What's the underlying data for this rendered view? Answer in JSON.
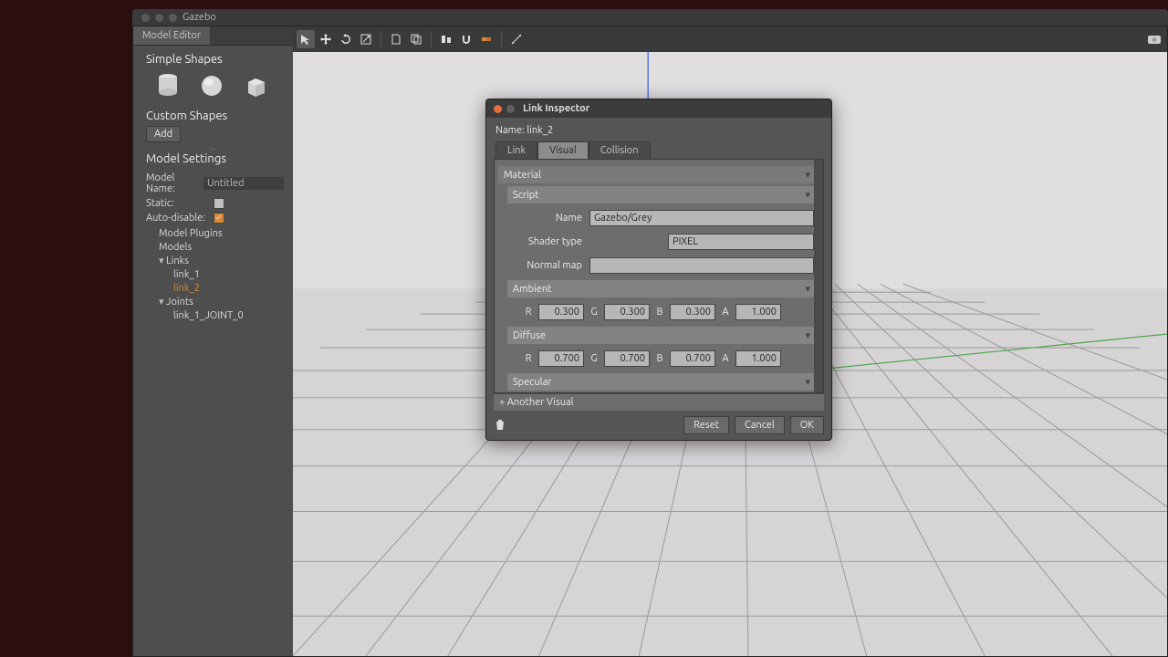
{
  "window": {
    "title": "Gazebo"
  },
  "tabs": {
    "model_editor": "Model Editor"
  },
  "sidebar": {
    "simple_shapes_header": "Simple Shapes",
    "custom_shapes_header": "Custom Shapes",
    "add_button": "Add",
    "model_settings_header": "Model Settings",
    "model_name_label": "Model Name:",
    "model_name_value": "Untitled",
    "static_label": "Static:",
    "auto_disable_label": "Auto-disable:",
    "tree": {
      "model_plugins": "Model Plugins",
      "models": "Models",
      "links": "Links",
      "link_1": "link_1",
      "link_2": "link_2",
      "joints": "Joints",
      "joint_0": "link_1_JOINT_0"
    }
  },
  "inspector": {
    "title": "Link Inspector",
    "name_label": "Name:",
    "name_value": "link_2",
    "tabs": {
      "link": "Link",
      "visual": "Visual",
      "collision": "Collision"
    },
    "panels": {
      "material": "Material",
      "script": "Script",
      "name_label": "Name",
      "name_value": "Gazebo/Grey",
      "shader_type_label": "Shader type",
      "shader_type_value": "PIXEL",
      "normal_map_label": "Normal map",
      "normal_map_value": "",
      "ambient": "Ambient",
      "ambient_rgba": {
        "r": "0.300",
        "g": "0.300",
        "b": "0.300",
        "a": "1.000"
      },
      "diffuse": "Diffuse",
      "diffuse_rgba": {
        "r": "0.700",
        "g": "0.700",
        "b": "0.700",
        "a": "1.000"
      },
      "specular": "Specular"
    },
    "rgba_labels": {
      "r": "R",
      "g": "G",
      "b": "B",
      "a": "A"
    },
    "add_another": "+ Another Visual",
    "buttons": {
      "reset": "Reset",
      "cancel": "Cancel",
      "ok": "OK"
    }
  }
}
